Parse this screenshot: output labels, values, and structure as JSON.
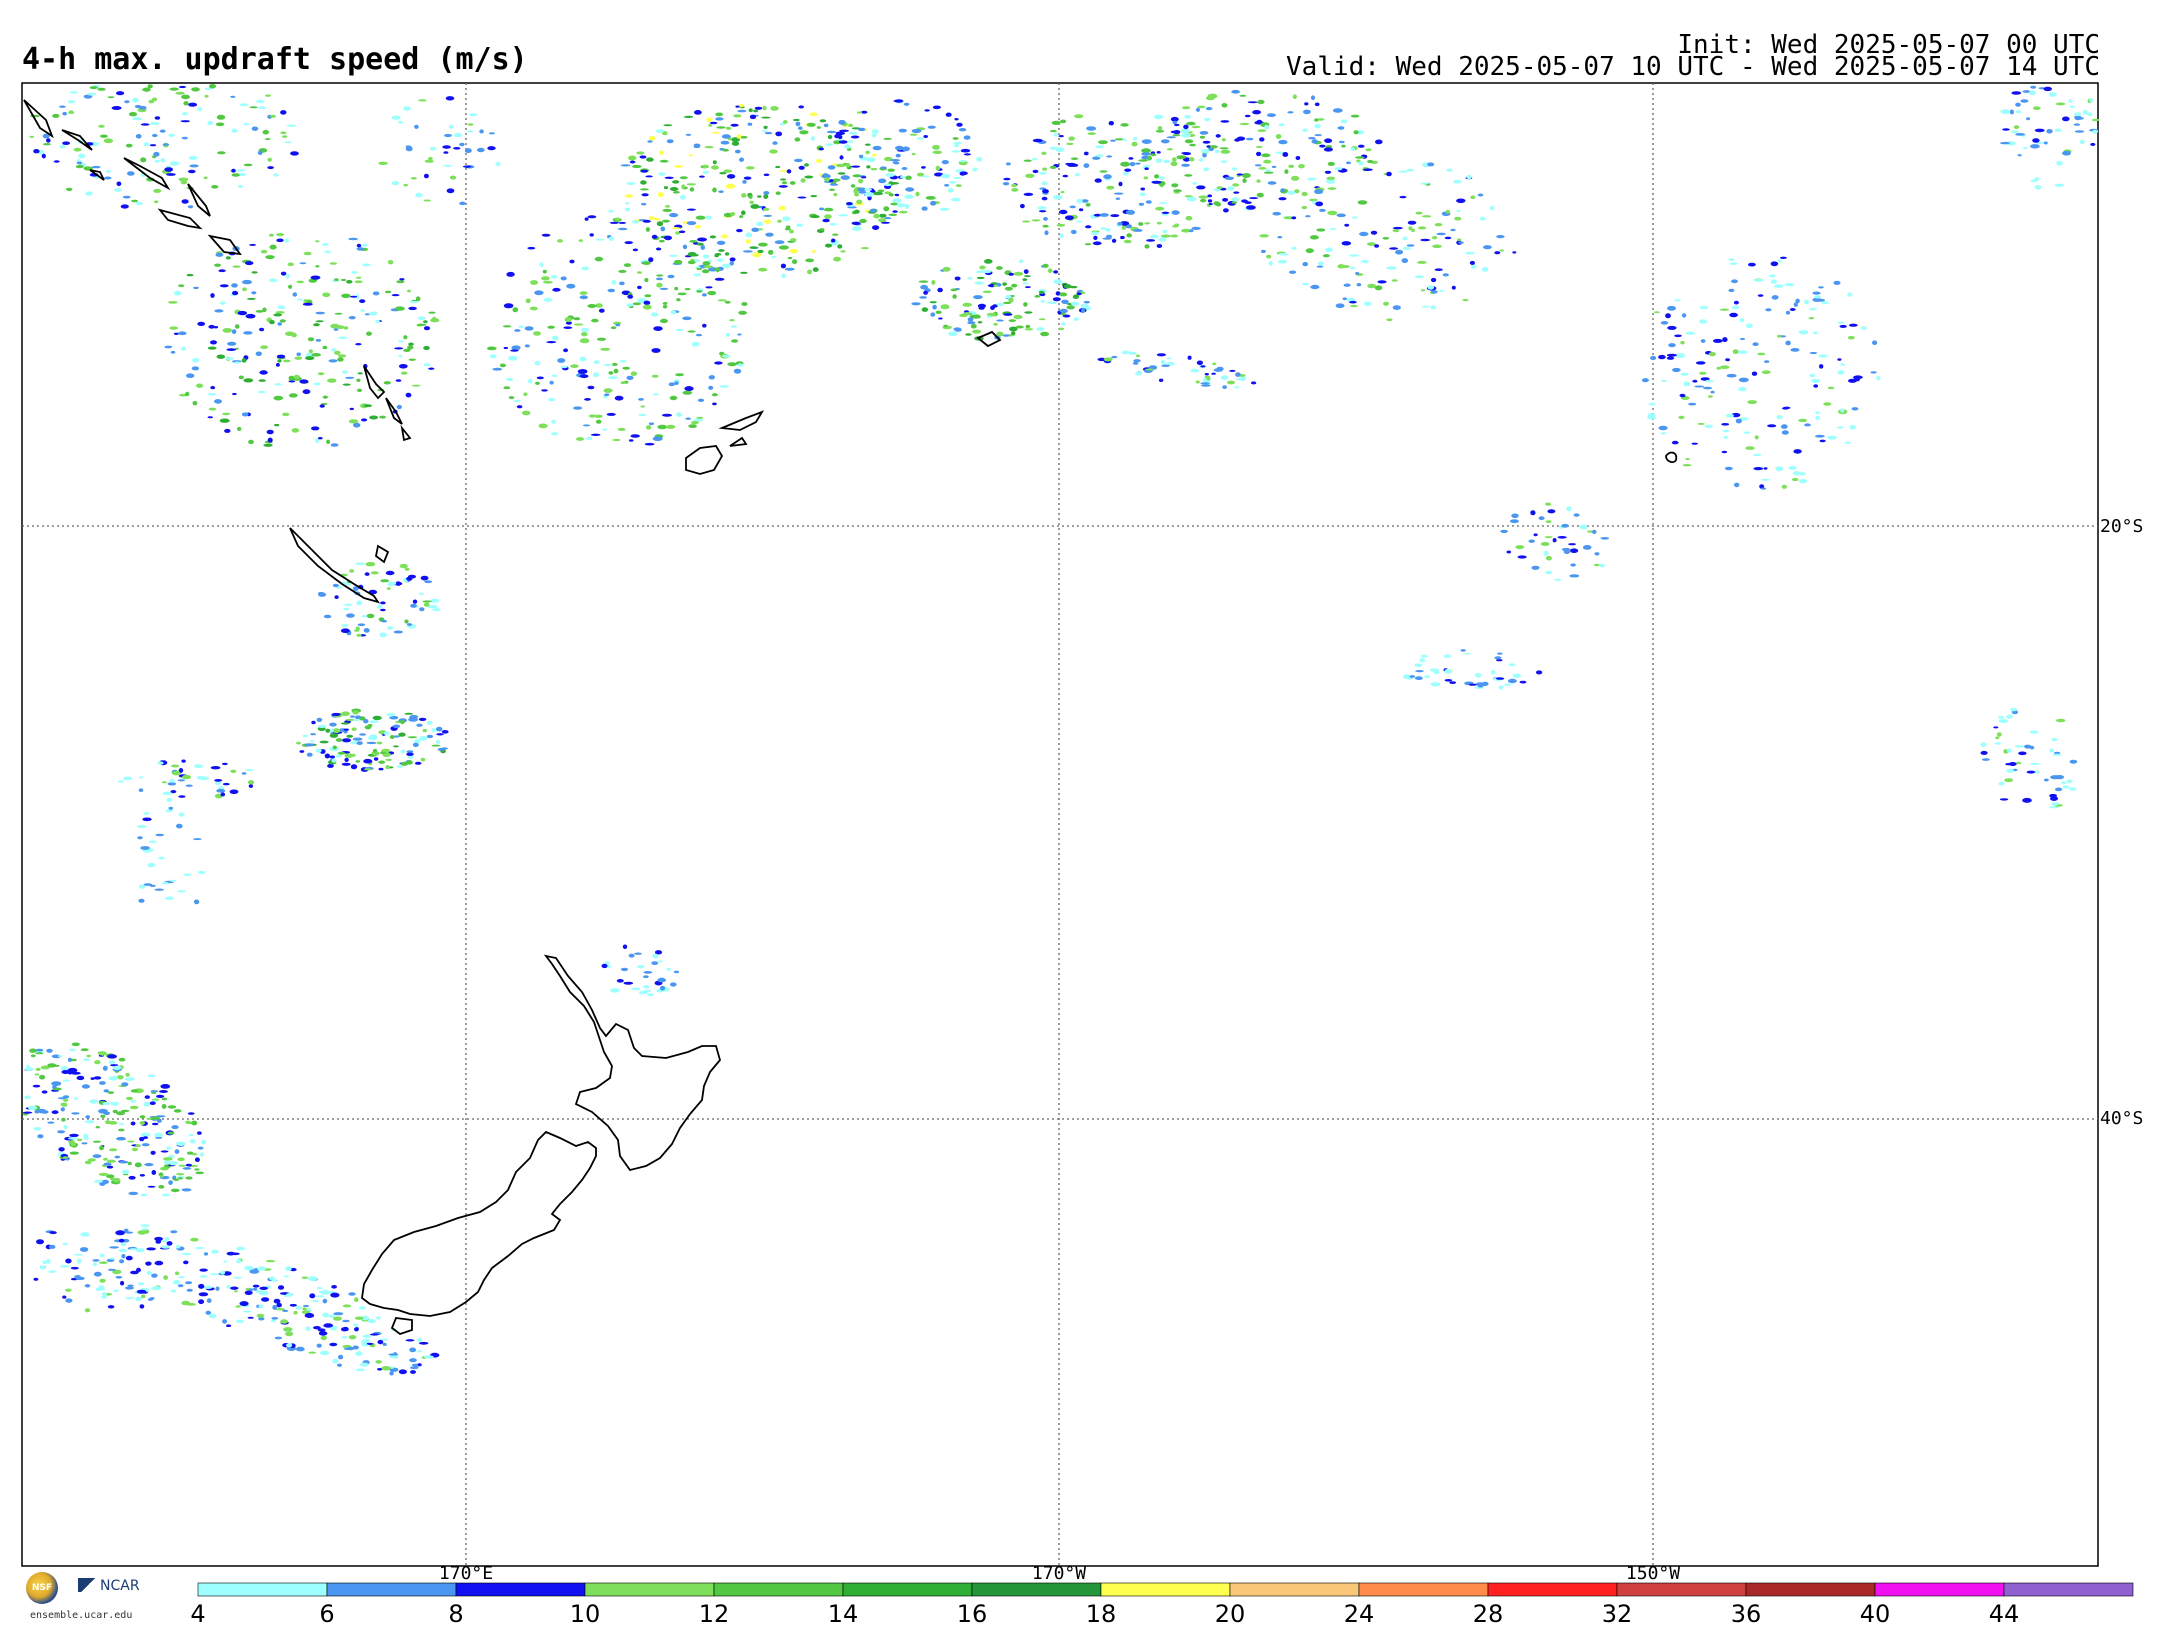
{
  "header": {
    "title": "4-h max. updraft speed (m/s)",
    "init": "Init: Wed 2025-05-07 00 UTC",
    "valid": "Valid: Wed 2025-05-07 10 UTC - Wed 2025-05-07 14 UTC"
  },
  "map": {
    "lon_labels": [
      "170°E",
      "170°W",
      "150°W"
    ],
    "lat_labels": [
      "20°S",
      "40°S"
    ]
  },
  "colorbar": {
    "ticks": [
      "4",
      "6",
      "8",
      "10",
      "12",
      "14",
      "16",
      "18",
      "20",
      "24",
      "28",
      "32",
      "36",
      "40",
      "44"
    ],
    "colors": [
      "#9effff",
      "#4a96f0",
      "#1010f0",
      "#7ee05a",
      "#52c842",
      "#2eae34",
      "#24963a",
      "#ffff50",
      "#f8c878",
      "#ff8c4a",
      "#ff2020",
      "#d04040",
      "#a82828",
      "#f010f0",
      "#9060d0"
    ]
  },
  "branding": {
    "nsf": "NSF",
    "ncar": "NCAR",
    "site": "ensemble.ucar.edu"
  }
}
